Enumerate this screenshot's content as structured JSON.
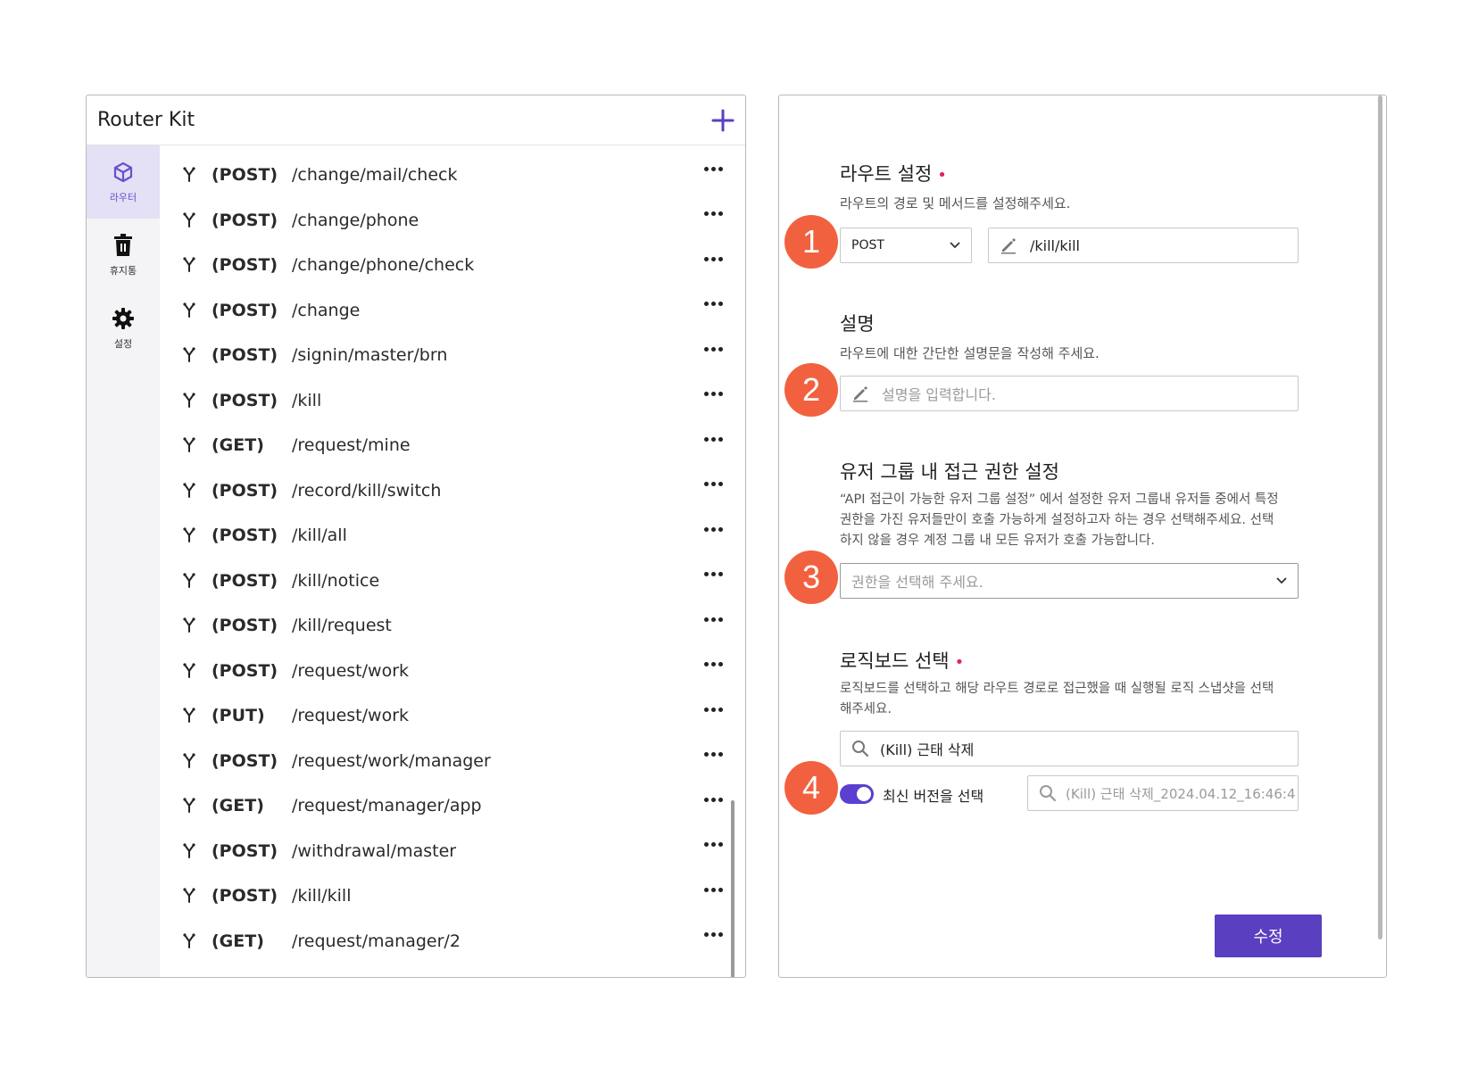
{
  "app": {
    "title": "Router Kit"
  },
  "sidebar": {
    "items": [
      {
        "label": "라우터",
        "icon": "router-cube-icon",
        "active": true
      },
      {
        "label": "휴지통",
        "icon": "trash-icon",
        "active": false
      },
      {
        "label": "설정",
        "icon": "gear-icon",
        "active": false
      }
    ]
  },
  "routes": [
    {
      "method": "(POST)",
      "path": "/change/mail/check"
    },
    {
      "method": "(POST)",
      "path": "/change/phone"
    },
    {
      "method": "(POST)",
      "path": "/change/phone/check"
    },
    {
      "method": "(POST)",
      "path": "/change"
    },
    {
      "method": "(POST)",
      "path": "/signin/master/brn"
    },
    {
      "method": "(POST)",
      "path": "/kill"
    },
    {
      "method": "(GET)",
      "path": "/request/mine"
    },
    {
      "method": "(POST)",
      "path": "/record/kill/switch"
    },
    {
      "method": "(POST)",
      "path": "/kill/all"
    },
    {
      "method": "(POST)",
      "path": "/kill/notice"
    },
    {
      "method": "(POST)",
      "path": "/kill/request"
    },
    {
      "method": "(POST)",
      "path": "/request/work"
    },
    {
      "method": "(PUT)",
      "path": "/request/work"
    },
    {
      "method": "(POST)",
      "path": "/request/work/manager"
    },
    {
      "method": "(GET)",
      "path": "/request/manager/app"
    },
    {
      "method": "(POST)",
      "path": "/withdrawal/master"
    },
    {
      "method": "(POST)",
      "path": "/kill/kill"
    },
    {
      "method": "(GET)",
      "path": "/request/manager/2"
    }
  ],
  "form": {
    "route": {
      "title": "라우트 설정",
      "required_mark": "•",
      "desc": "라우트의 경로 및 메서드를 설정해주세요.",
      "method_value": "POST",
      "path_value": "/kill/kill",
      "badge": "1"
    },
    "description": {
      "title": "설명",
      "desc": "라우트에 대한 간단한 설명문을 작성해 주세요.",
      "placeholder": "설명을 입력합니다.",
      "badge": "2"
    },
    "access": {
      "title": "유저 그룹 내 접근 권한 설정",
      "desc_line1": "“API 접근이 가능한 유저 그룹 설정” 에서 설정한 유저 그룹내 유저들 중에서 특정",
      "desc_line2": "권한을 가진 유저들만이 호출 가능하게 설정하고자 하는 경우 선택해주세요. 선택",
      "desc_line3": "하지 않을 경우 계정 그룹 내 모든 유저가 호출 가능합니다.",
      "placeholder": "권한을 선택해 주세요.",
      "badge": "3"
    },
    "logicboard": {
      "title": "로직보드 선택",
      "required_mark": "•",
      "desc_line1": "로직보드를 선택하고 해당 라우트 경로로 접근했을 때 실행될 로직 스냅샷을 선택",
      "desc_line2": "해주세요.",
      "board_value": "(Kill) 근태 삭제",
      "toggle_label": "최신 버전을 선택",
      "toggle_on": true,
      "snapshot_value": "(Kill) 근태 삭제_2024.04.12_16:46:4",
      "badge": "4"
    },
    "submit_label": "수정"
  },
  "colors": {
    "accent": "#5a3fc0",
    "badge": "#f2613f",
    "required": "#e0245e"
  }
}
